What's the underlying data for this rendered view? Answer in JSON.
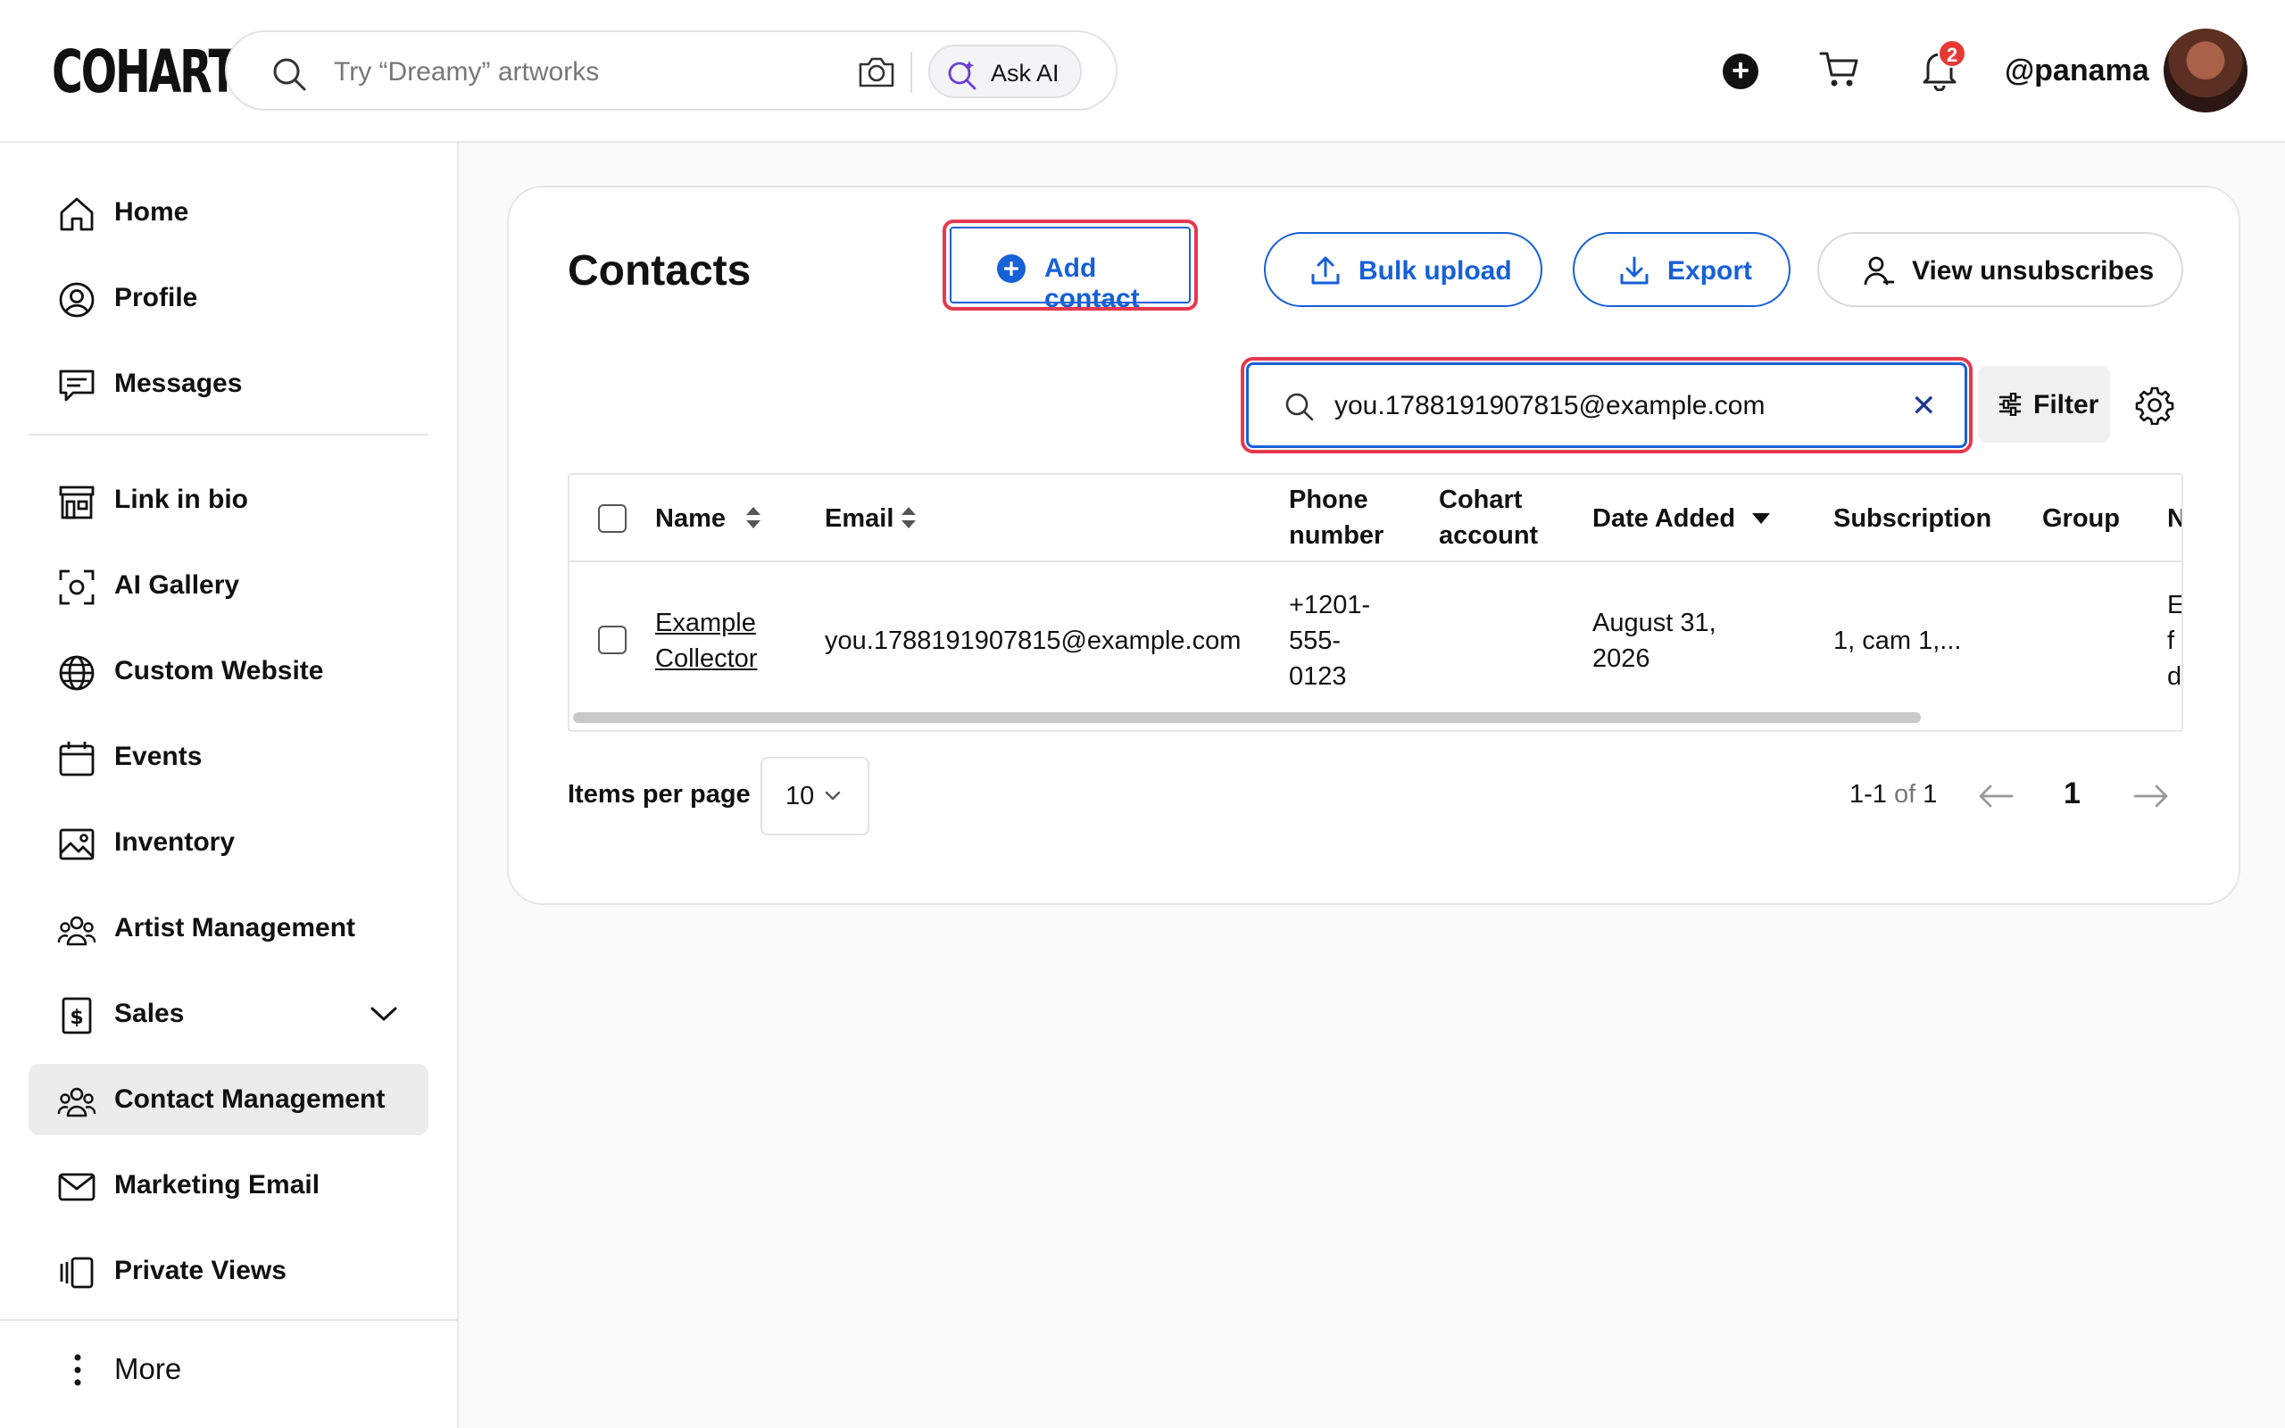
{
  "header": {
    "logo": "COHART",
    "search_placeholder": "Try “Dreamy” artworks",
    "ask_ai_label": "Ask AI",
    "notification_count": "2",
    "username": "@panama"
  },
  "sidebar": {
    "items": [
      {
        "label": "Home",
        "icon": "home-icon"
      },
      {
        "label": "Profile",
        "icon": "profile-icon"
      },
      {
        "label": "Messages",
        "icon": "messages-icon"
      },
      {
        "label": "Link in bio",
        "icon": "storefront-icon"
      },
      {
        "label": "AI Gallery",
        "icon": "scan-icon"
      },
      {
        "label": "Custom Website",
        "icon": "globe-icon"
      },
      {
        "label": "Events",
        "icon": "calendar-icon"
      },
      {
        "label": "Inventory",
        "icon": "image-icon"
      },
      {
        "label": "Artist Management",
        "icon": "group-icon"
      },
      {
        "label": "Sales",
        "icon": "dollar-doc-icon"
      },
      {
        "label": "Contact Management",
        "icon": "group-icon"
      },
      {
        "label": "Marketing Email",
        "icon": "mail-icon"
      },
      {
        "label": "Private Views",
        "icon": "private-views-icon"
      }
    ],
    "active": "Contact Management",
    "more_label": "More"
  },
  "contacts": {
    "title": "Contacts",
    "add_contact_label": "Add contact",
    "bulk_upload_label": "Bulk upload",
    "export_label": "Export",
    "view_unsubscribes_label": "View unsubscribes",
    "search_value": "you.1788191907815@example.com",
    "filter_label": "Filter",
    "columns": {
      "name": "Name",
      "email": "Email",
      "phone_l1": "Phone",
      "phone_l2": "number",
      "cohart_l1": "Cohart",
      "cohart_l2": "account",
      "date_added": "Date Added",
      "subscription": "Subscription",
      "group": "Group",
      "next_partial": "N"
    },
    "rows": [
      {
        "name_l1": "Example",
        "name_l2": "Collector",
        "email": "you.1788191907815@example.com",
        "phone_l1": "+1201-",
        "phone_l2": "555-",
        "phone_l3": "0123",
        "date_l1": "August 31,",
        "date_l2": "2026",
        "subscription": "1, cam 1,...",
        "next_l1": "E",
        "next_l2": "f",
        "next_l3": "d"
      }
    ],
    "items_per_page_label": "Items per page",
    "items_per_page": "10",
    "range_start": "1-1",
    "range_of": "of",
    "range_total": "1",
    "current_page": "1"
  },
  "colors": {
    "accent": "#1660d8",
    "highlight": "#e53950",
    "badge": "#e53935"
  }
}
